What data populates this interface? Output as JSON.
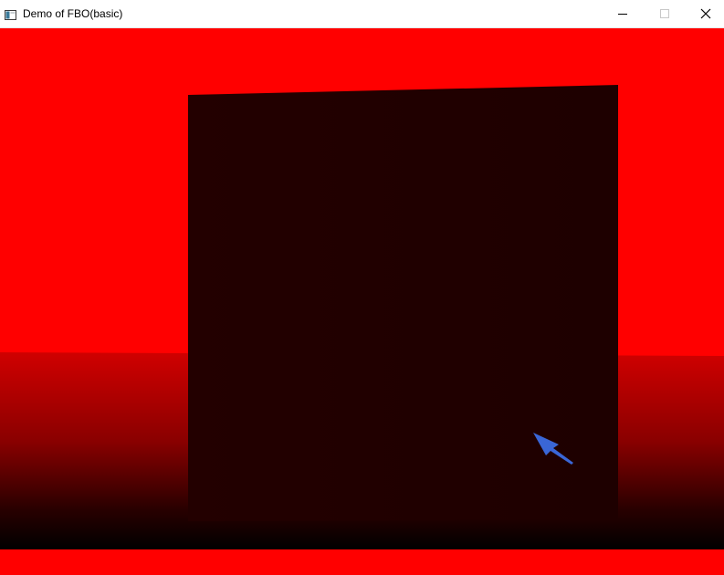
{
  "window": {
    "title": "Demo of FBO(basic)",
    "app_icon": "window-app-icon",
    "controls": [
      "minimize-icon",
      "maximize-icon",
      "close-icon"
    ]
  },
  "scene": {
    "background_color": "#ff0000",
    "floor_gradient": [
      "#d00000",
      "#000000"
    ],
    "panel_color": "#200000",
    "pointer_color": "#3a66d6"
  }
}
